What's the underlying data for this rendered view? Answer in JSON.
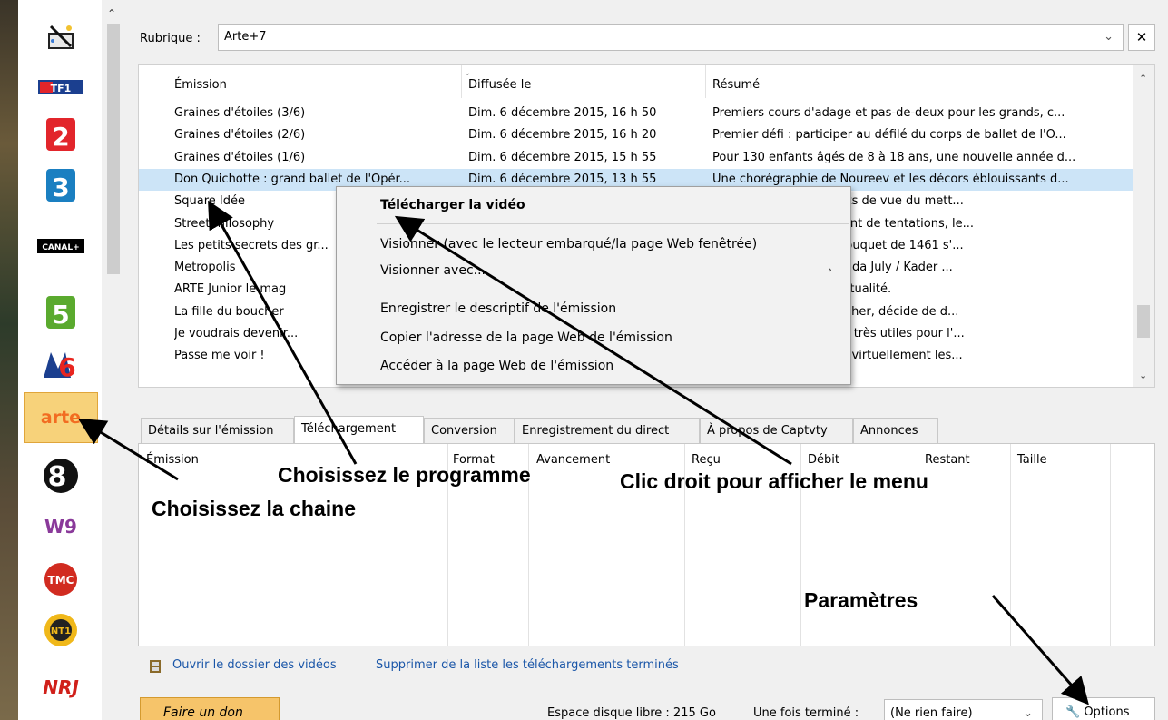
{
  "channels": [
    {
      "name": "app-logo",
      "label": ""
    },
    {
      "name": "tf1",
      "label": "TF1",
      "color": "#1b3f8f"
    },
    {
      "name": "france2",
      "label": "2",
      "color": "#e2252b"
    },
    {
      "name": "france3",
      "label": "3",
      "color": "#1a7fc1"
    },
    {
      "name": "canalplus",
      "label": "CANAL+",
      "color": "#000000"
    },
    {
      "name": "france5",
      "label": "5",
      "color": "#5aaa2e"
    },
    {
      "name": "m6",
      "label": "6",
      "color": "#e9251f"
    },
    {
      "name": "arte",
      "label": "arte",
      "color": "#f26c21"
    },
    {
      "name": "c8",
      "label": "8",
      "color": "#111111"
    },
    {
      "name": "w9",
      "label": "W9",
      "color": "#8a3a9a"
    },
    {
      "name": "tmc",
      "label": "TMC",
      "color": "#d12b20"
    },
    {
      "name": "nt1",
      "label": "NT1",
      "color": "#f0b81a"
    },
    {
      "name": "nrj12",
      "label": "NRJ",
      "color": "#d0201a"
    }
  ],
  "rubrique": {
    "label": "Rubrique :",
    "value": "Arte+7"
  },
  "list": {
    "headers": {
      "emission": "Émission",
      "diffusee": "Diffusée le",
      "resume": "Résumé"
    },
    "rows": [
      {
        "emission": "Graines d'étoiles (3/6)",
        "diffusee": "Dim. 6 décembre 2015, 16 h 50",
        "resume": "Premiers cours d'adage et pas-de-deux pour les grands, c..."
      },
      {
        "emission": "Graines d'étoiles (2/6)",
        "diffusee": "Dim. 6 décembre 2015, 16 h 20",
        "resume": "Premier défi : participer au défilé du corps de ballet de l'O..."
      },
      {
        "emission": "Graines d'étoiles (1/6)",
        "diffusee": "Dim. 6 décembre 2015, 15 h 55",
        "resume": "Pour 130 enfants âgés de 8 à 18 ans, une nouvelle année d..."
      },
      {
        "emission": "Don Quichotte : grand ballet de l'Opér...",
        "diffusee": "Dim. 6 décembre 2015, 13 h 55",
        "resume": "Une chorégraphie de Noureev et les décors éblouissants d...",
        "selected": true
      },
      {
        "emission": "Square Idée",
        "diffusee": "",
        "resume": "...intermède ? Les points de vue du mett..."
      },
      {
        "emission": "Streetphilosophy",
        "diffusee": "",
        "resume": "...grande ville regorgeant de tentations, le..."
      },
      {
        "emission": "Les petits secrets des gr...",
        "diffusee": "",
        "resume": "...e Apolline\" de Jean Fouquet de 1461 s'..."
      },
      {
        "emission": "Metropolis",
        "diffusee": "",
        "resume": "...t le terrorisme / Miranda July / Kader ..."
      },
      {
        "emission": "ARTE Junior le mag",
        "diffusee": "",
        "resume": "...pour comprendre l'actualité."
      },
      {
        "emission": "La fille du boucher",
        "diffusee": "",
        "resume": "...ron, Sila, fille de boucher, décide de d..."
      },
      {
        "emission": "Je voudrais devenir...",
        "diffusee": "",
        "resume": "...ntretient des rapaces très utiles pour l'..."
      },
      {
        "emission": "Passe me voir !",
        "diffusee": "",
        "resume": "...ol of the Air scolarise virtuellement les..."
      }
    ]
  },
  "context_menu": {
    "download": "Télécharger la vidéo",
    "watch_embedded": "Visionner (avec le lecteur embarqué/la page Web fenêtrée)",
    "watch_with": "Visionner avec...",
    "save_description": "Enregistrer le descriptif de l'émission",
    "copy_address": "Copier l'adresse de la page Web de l'émission",
    "open_page": "Accéder à la page Web de l'émission"
  },
  "tabs": [
    {
      "label": "Détails sur l'émission"
    },
    {
      "label": "Téléchargement",
      "active": true
    },
    {
      "label": "Conversion"
    },
    {
      "label": "Enregistrement du direct"
    },
    {
      "label": "À propos de Captvty"
    },
    {
      "label": "Annonces"
    }
  ],
  "downloads": {
    "headers": [
      "Émission",
      "Format",
      "Avancement",
      "Reçu",
      "Débit",
      "Restant",
      "Taille"
    ]
  },
  "links": {
    "open_folder": "Ouvrir le dossier des vidéos",
    "clear_finished": "Supprimer de la liste les téléchargements terminés"
  },
  "footer": {
    "donate": "Faire un don",
    "disk_space": "Espace disque libre : 215 Go",
    "when_done_label": "Une fois terminé :",
    "when_done_value": "(Ne rien faire)",
    "options": "Options"
  },
  "annotations": {
    "choose_program": "Choisissez le programme",
    "right_click": "Clic droit pour afficher le menu",
    "choose_channel": "Choisissez la chaine",
    "settings": "Paramètres"
  }
}
